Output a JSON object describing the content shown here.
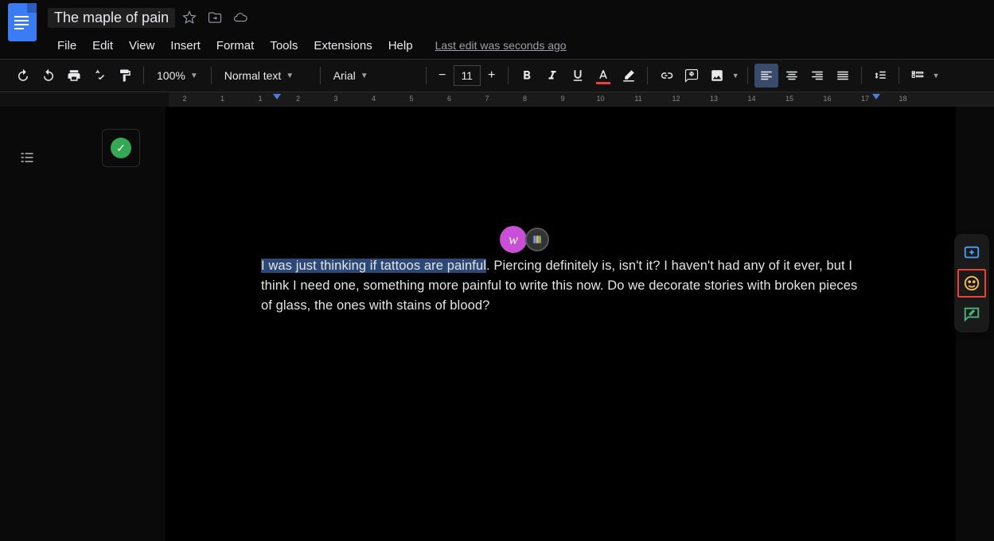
{
  "document": {
    "title": "The maple of pain",
    "last_edit_text": "Last edit was seconds ago",
    "body_highlighted": "I was just thinking if tattoos are painful",
    "body_rest": ". Piercing definitely is, isn't it? I haven't had any of it ever, but I think I need one, something more painful to write this now. Do we decorate stories with broken pieces of glass, the ones with stains of blood?"
  },
  "menu": {
    "items": [
      "File",
      "Edit",
      "View",
      "Insert",
      "Format",
      "Tools",
      "Extensions",
      "Help"
    ]
  },
  "toolbar": {
    "zoom": "100%",
    "paragraph_style": "Normal text",
    "font_family": "Arial",
    "font_size": "11"
  },
  "ruler": {
    "numbers": [
      "2",
      "1",
      "1",
      "2",
      "3",
      "4",
      "5",
      "6",
      "7",
      "8",
      "9",
      "10",
      "11",
      "12",
      "13",
      "14",
      "15",
      "16",
      "17",
      "18"
    ]
  },
  "collaborator": {
    "initial": "w"
  }
}
